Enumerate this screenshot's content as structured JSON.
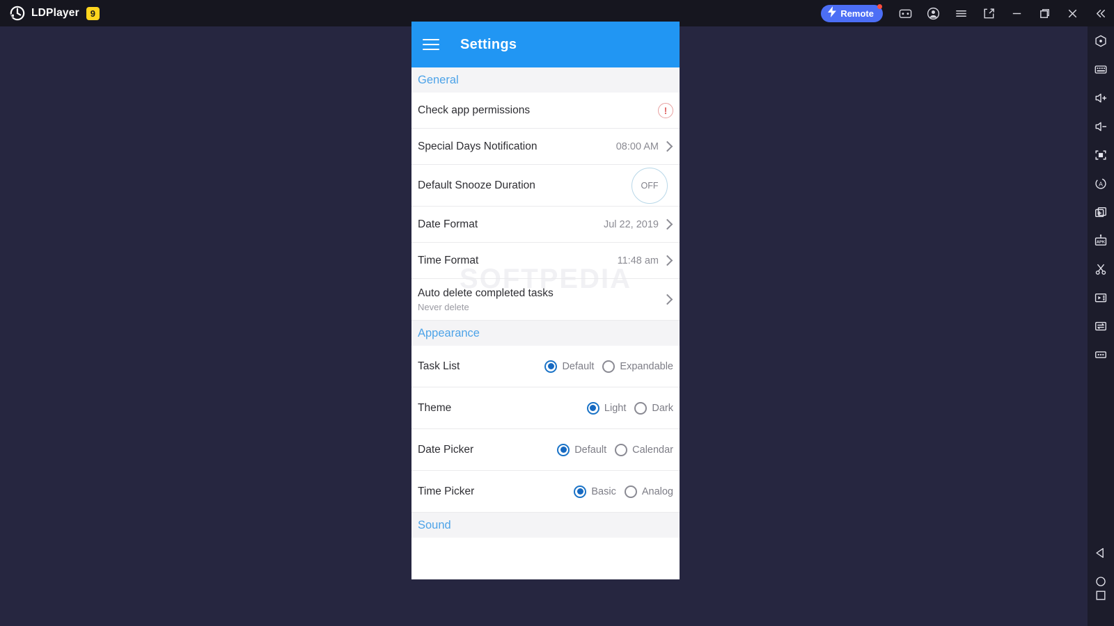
{
  "titlebar": {
    "brand": "LDPlayer",
    "version_badge": "9",
    "remote_label": "Remote",
    "icons": [
      {
        "name": "gamepad-icon"
      },
      {
        "name": "account-icon"
      },
      {
        "name": "menu-icon"
      },
      {
        "name": "fullscreen-icon"
      },
      {
        "name": "minimize-icon"
      },
      {
        "name": "maximize-icon"
      },
      {
        "name": "close-icon"
      },
      {
        "name": "collapse-icon"
      }
    ]
  },
  "sidebar": {
    "icons": [
      {
        "name": "shake-icon"
      },
      {
        "name": "keyboard-icon"
      },
      {
        "name": "volume-up-icon"
      },
      {
        "name": "volume-down-icon"
      },
      {
        "name": "screenshot-icon"
      },
      {
        "name": "auto-rotate-icon"
      },
      {
        "name": "multi-instance-icon"
      },
      {
        "name": "apk-install-icon"
      },
      {
        "name": "scissors-icon"
      },
      {
        "name": "video-record-icon"
      },
      {
        "name": "file-transfer-icon"
      },
      {
        "name": "more-options-icon"
      }
    ],
    "nav_icons": [
      {
        "name": "android-back-icon"
      },
      {
        "name": "android-home-icon"
      },
      {
        "name": "android-recents-icon"
      }
    ]
  },
  "app": {
    "appbar": {
      "menu_icon": "hamburger-icon",
      "title": "Settings"
    },
    "watermark": "SOFTPEDIA",
    "sections": [
      {
        "header": "General",
        "rows": [
          {
            "kind": "warning",
            "title": "Check app permissions",
            "warning_glyph": "!"
          },
          {
            "kind": "value",
            "title": "Special Days Notification",
            "value": "08:00 AM"
          },
          {
            "kind": "snooze",
            "title": "Default Snooze Duration",
            "value": "OFF"
          },
          {
            "kind": "value",
            "title": "Date Format",
            "value": "Jul 22, 2019"
          },
          {
            "kind": "value",
            "title": "Time Format",
            "value": "11:48 am"
          },
          {
            "kind": "sub",
            "title": "Auto delete completed tasks",
            "subtitle": "Never delete"
          }
        ]
      },
      {
        "header": "Appearance",
        "rows": [
          {
            "kind": "radio",
            "title": "Task List",
            "options": [
              {
                "label": "Default",
                "selected": true
              },
              {
                "label": "Expandable",
                "selected": false
              }
            ]
          },
          {
            "kind": "radio",
            "title": "Theme",
            "options": [
              {
                "label": "Light",
                "selected": true
              },
              {
                "label": "Dark",
                "selected": false
              }
            ]
          },
          {
            "kind": "radio",
            "title": "Date Picker",
            "options": [
              {
                "label": "Default",
                "selected": true
              },
              {
                "label": "Calendar",
                "selected": false
              }
            ]
          },
          {
            "kind": "radio",
            "title": "Time Picker",
            "options": [
              {
                "label": "Basic",
                "selected": true
              },
              {
                "label": "Analog",
                "selected": false
              }
            ]
          }
        ]
      },
      {
        "header": "Sound",
        "rows": []
      }
    ]
  },
  "colors": {
    "accent_blue": "#2196f3",
    "section_header_text": "#4da3e8",
    "radio_selected": "#1669c1",
    "remote_button": "#4c6ef5",
    "badge_yellow": "#ffd51e",
    "warning_red": "#e06666",
    "window_bg": "#262640",
    "titlebar_bg": "#16161f",
    "sidebar_bg": "#1c1c2b"
  }
}
